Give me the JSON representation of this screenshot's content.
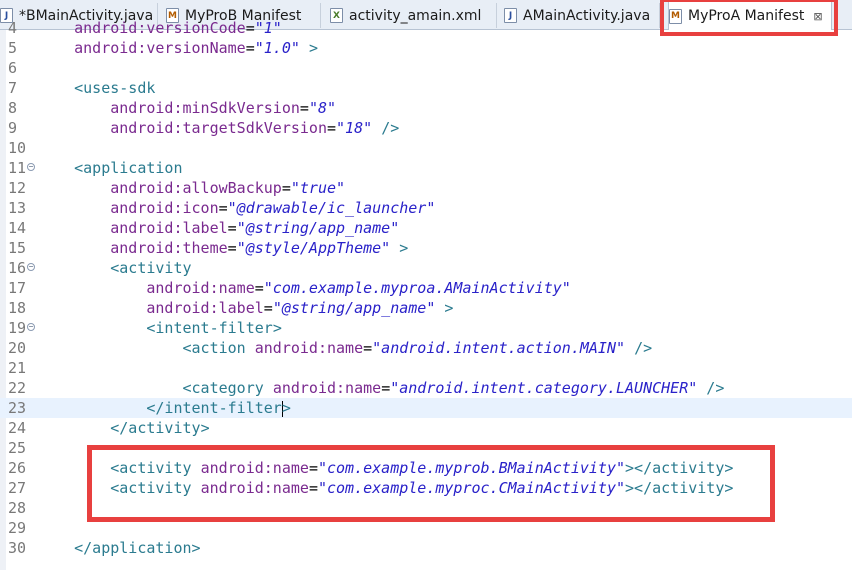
{
  "tabs": [
    {
      "label": "*BMainActivity.java",
      "icon": "java-file-icon"
    },
    {
      "label": "MyProB Manifest",
      "icon": "manifest-icon"
    },
    {
      "label": "activity_amain.xml",
      "icon": "xml-file-icon"
    },
    {
      "label": "AMainActivity.java",
      "icon": "java-file-icon"
    },
    {
      "label": "MyProA Manifest",
      "icon": "manifest-icon",
      "active": true,
      "close": "⊠"
    }
  ],
  "editor": {
    "lines": [
      {
        "n": "4",
        "code": "    android:versionCode=\"1\""
      },
      {
        "n": "5",
        "code": "    android:versionName=\"1.0\" >"
      },
      {
        "n": "6",
        "code": ""
      },
      {
        "n": "7",
        "code": "    <uses-sdk"
      },
      {
        "n": "8",
        "code": "        android:minSdkVersion=\"8\""
      },
      {
        "n": "9",
        "code": "        android:targetSdkVersion=\"18\" />"
      },
      {
        "n": "10",
        "code": ""
      },
      {
        "n": "11",
        "code": "    <application",
        "fold": true
      },
      {
        "n": "12",
        "code": "        android:allowBackup=\"true\""
      },
      {
        "n": "13",
        "code": "        android:icon=\"@drawable/ic_launcher\""
      },
      {
        "n": "14",
        "code": "        android:label=\"@string/app_name\""
      },
      {
        "n": "15",
        "code": "        android:theme=\"@style/AppTheme\" >"
      },
      {
        "n": "16",
        "code": "        <activity",
        "fold": true
      },
      {
        "n": "17",
        "code": "            android:name=\"com.example.myproa.AMainActivity\""
      },
      {
        "n": "18",
        "code": "            android:label=\"@string/app_name\" >"
      },
      {
        "n": "19",
        "code": "            <intent-filter>",
        "fold": true
      },
      {
        "n": "20",
        "code": "                <action android:name=\"android.intent.action.MAIN\" />"
      },
      {
        "n": "21",
        "code": ""
      },
      {
        "n": "22",
        "code": "                <category android:name=\"android.intent.category.LAUNCHER\" />"
      },
      {
        "n": "23",
        "code": "            </intent-filter>",
        "current": true
      },
      {
        "n": "24",
        "code": "        </activity>"
      },
      {
        "n": "25",
        "code": ""
      },
      {
        "n": "26",
        "code": "        <activity android:name=\"com.example.myprob.BMainActivity\"></activity>"
      },
      {
        "n": "27",
        "code": "        <activity android:name=\"com.example.myproc.CMainActivity\"></activity>"
      },
      {
        "n": "28",
        "code": ""
      },
      {
        "n": "29",
        "code": ""
      },
      {
        "n": "30",
        "code": "    </application>"
      }
    ]
  },
  "colors": {
    "highlight": "#e8403f",
    "tag": "#2b7b8f",
    "attribute": "#7a2a8f",
    "value": "#2a22c9"
  }
}
